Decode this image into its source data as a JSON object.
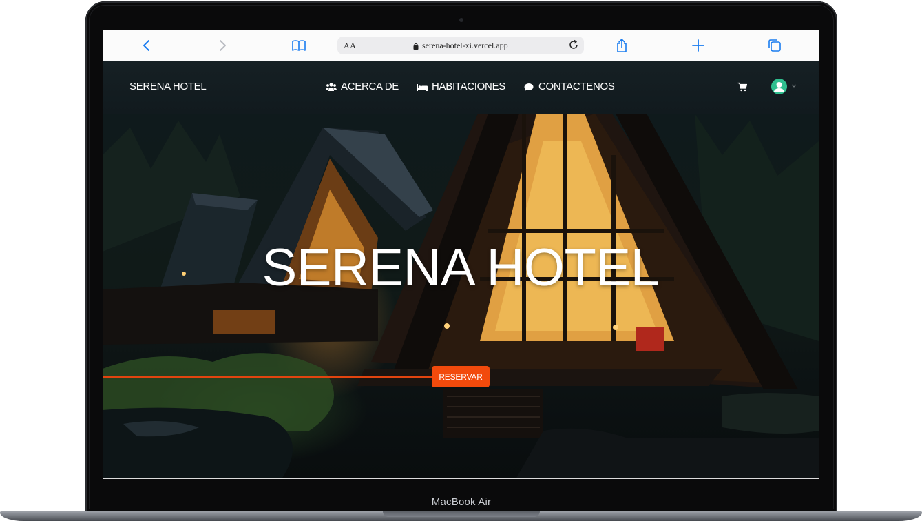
{
  "device": {
    "label": "MacBook Air"
  },
  "browser": {
    "text_size_label": "AA",
    "url": "serena-hotel-xi.vercel.app"
  },
  "site": {
    "brand": "SERENA HOTEL",
    "nav": [
      {
        "label": "ACERCA DE",
        "icon": "users-icon"
      },
      {
        "label": "HABITACIONES",
        "icon": "bed-icon"
      },
      {
        "label": "CONTACTENOS",
        "icon": "chat-icon"
      }
    ],
    "cart_icon": "cart-icon",
    "avatar_icon": "user-avatar-icon",
    "accent_color": "#f24a0c"
  },
  "hero": {
    "title": "SERENA HOTEL",
    "cta_label": "RESERVAR"
  }
}
